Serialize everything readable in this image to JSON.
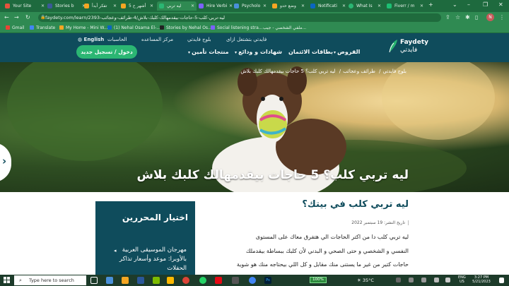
{
  "browser": {
    "tabs": [
      {
        "title": "Your Site",
        "color": "#e5533d"
      },
      {
        "title": "Stories b",
        "color": "#3b5998"
      },
      {
        "title": "تفكر أبدأ",
        "color": "#f5a623"
      },
      {
        "title": "5 أشهر ح",
        "color": "#f5a623"
      },
      {
        "title": "ليه تربي",
        "color": "#2bb673"
      },
      {
        "title": "Hire Verbi",
        "color": "#7b61ff"
      },
      {
        "title": "Psycholo",
        "color": "#4a90d9"
      },
      {
        "title": "وضع حدو",
        "color": "#f5a623"
      },
      {
        "title": "Notificati",
        "color": "#0a66c2"
      },
      {
        "title": "What Is",
        "color": "#2bb673"
      },
      {
        "title": "Fiverr / m",
        "color": "#1dbf73"
      }
    ],
    "url": "faydety.com/learn/2393-ليه-تربي-كلب-5-حاجات-بيقدمهالك-كلبك-بلاش/4-طرائف-وعجائب",
    "bookmarks": [
      "Gmail",
      "Translate",
      "My Home - Mini W...",
      "(1) Nehal Osama El-...",
      "Stories by Nehal Os...",
      "Social listening stra...",
      "ملفي الشخصي - جيب..."
    ]
  },
  "site": {
    "logo_en": "Faydety",
    "logo_ar": "فايدتي",
    "top_links": {
      "how": "فايدتي بتشتغل ازاى",
      "blog": "بلوج فايدتي",
      "help": "مركز المساعده",
      "calculators": "الحاسبات",
      "lang": "English"
    },
    "nav": {
      "loans": "القروض",
      "cards": "بطاقات الائتمان",
      "savings": "شهادات و ودائع",
      "insurance": "منتجات تأمين"
    },
    "cta": "دخول / تسجيل جديد"
  },
  "hero": {
    "breadcrumb": [
      "بلوج فايدتي",
      "طرائف وعجائب",
      "ليه تربي كلب؟ 5 حاجات بيقدمهالك كلبك بلاش"
    ],
    "title": "ليه تربي كلب؟ 5 حاجات بيقدمهالك كلبك بلاش"
  },
  "article": {
    "heading": "ليه تربي كلب في بيتك؟",
    "date_label": "تاريخ النشر: 19 سبتمبر 2022",
    "lines": [
      "ليه تربي كلب دا من اكتر الحاجات الي هتفرق معاك على المستوى",
      "النفسي و الشخصي و حتى الصحي و البدني لأن كلبك ببساطة بيقدملك",
      "حاجات كتير من غير ما يستنى منك مقابل و كل اللي بيحتاجه منك هو شوية"
    ]
  },
  "picks": {
    "title": "اختيار المحررين",
    "item": "مهرجان الموسيقى العربية بالأوبرا: موعد وأسعار تذاكر الحفلات"
  },
  "taskbar": {
    "search_placeholder": "Type here to search",
    "battery": "100%",
    "weather": "35°C",
    "lang_top": "ENG",
    "lang_bottom": "US",
    "time": "3:27 PM",
    "date": "5/21/2023"
  }
}
